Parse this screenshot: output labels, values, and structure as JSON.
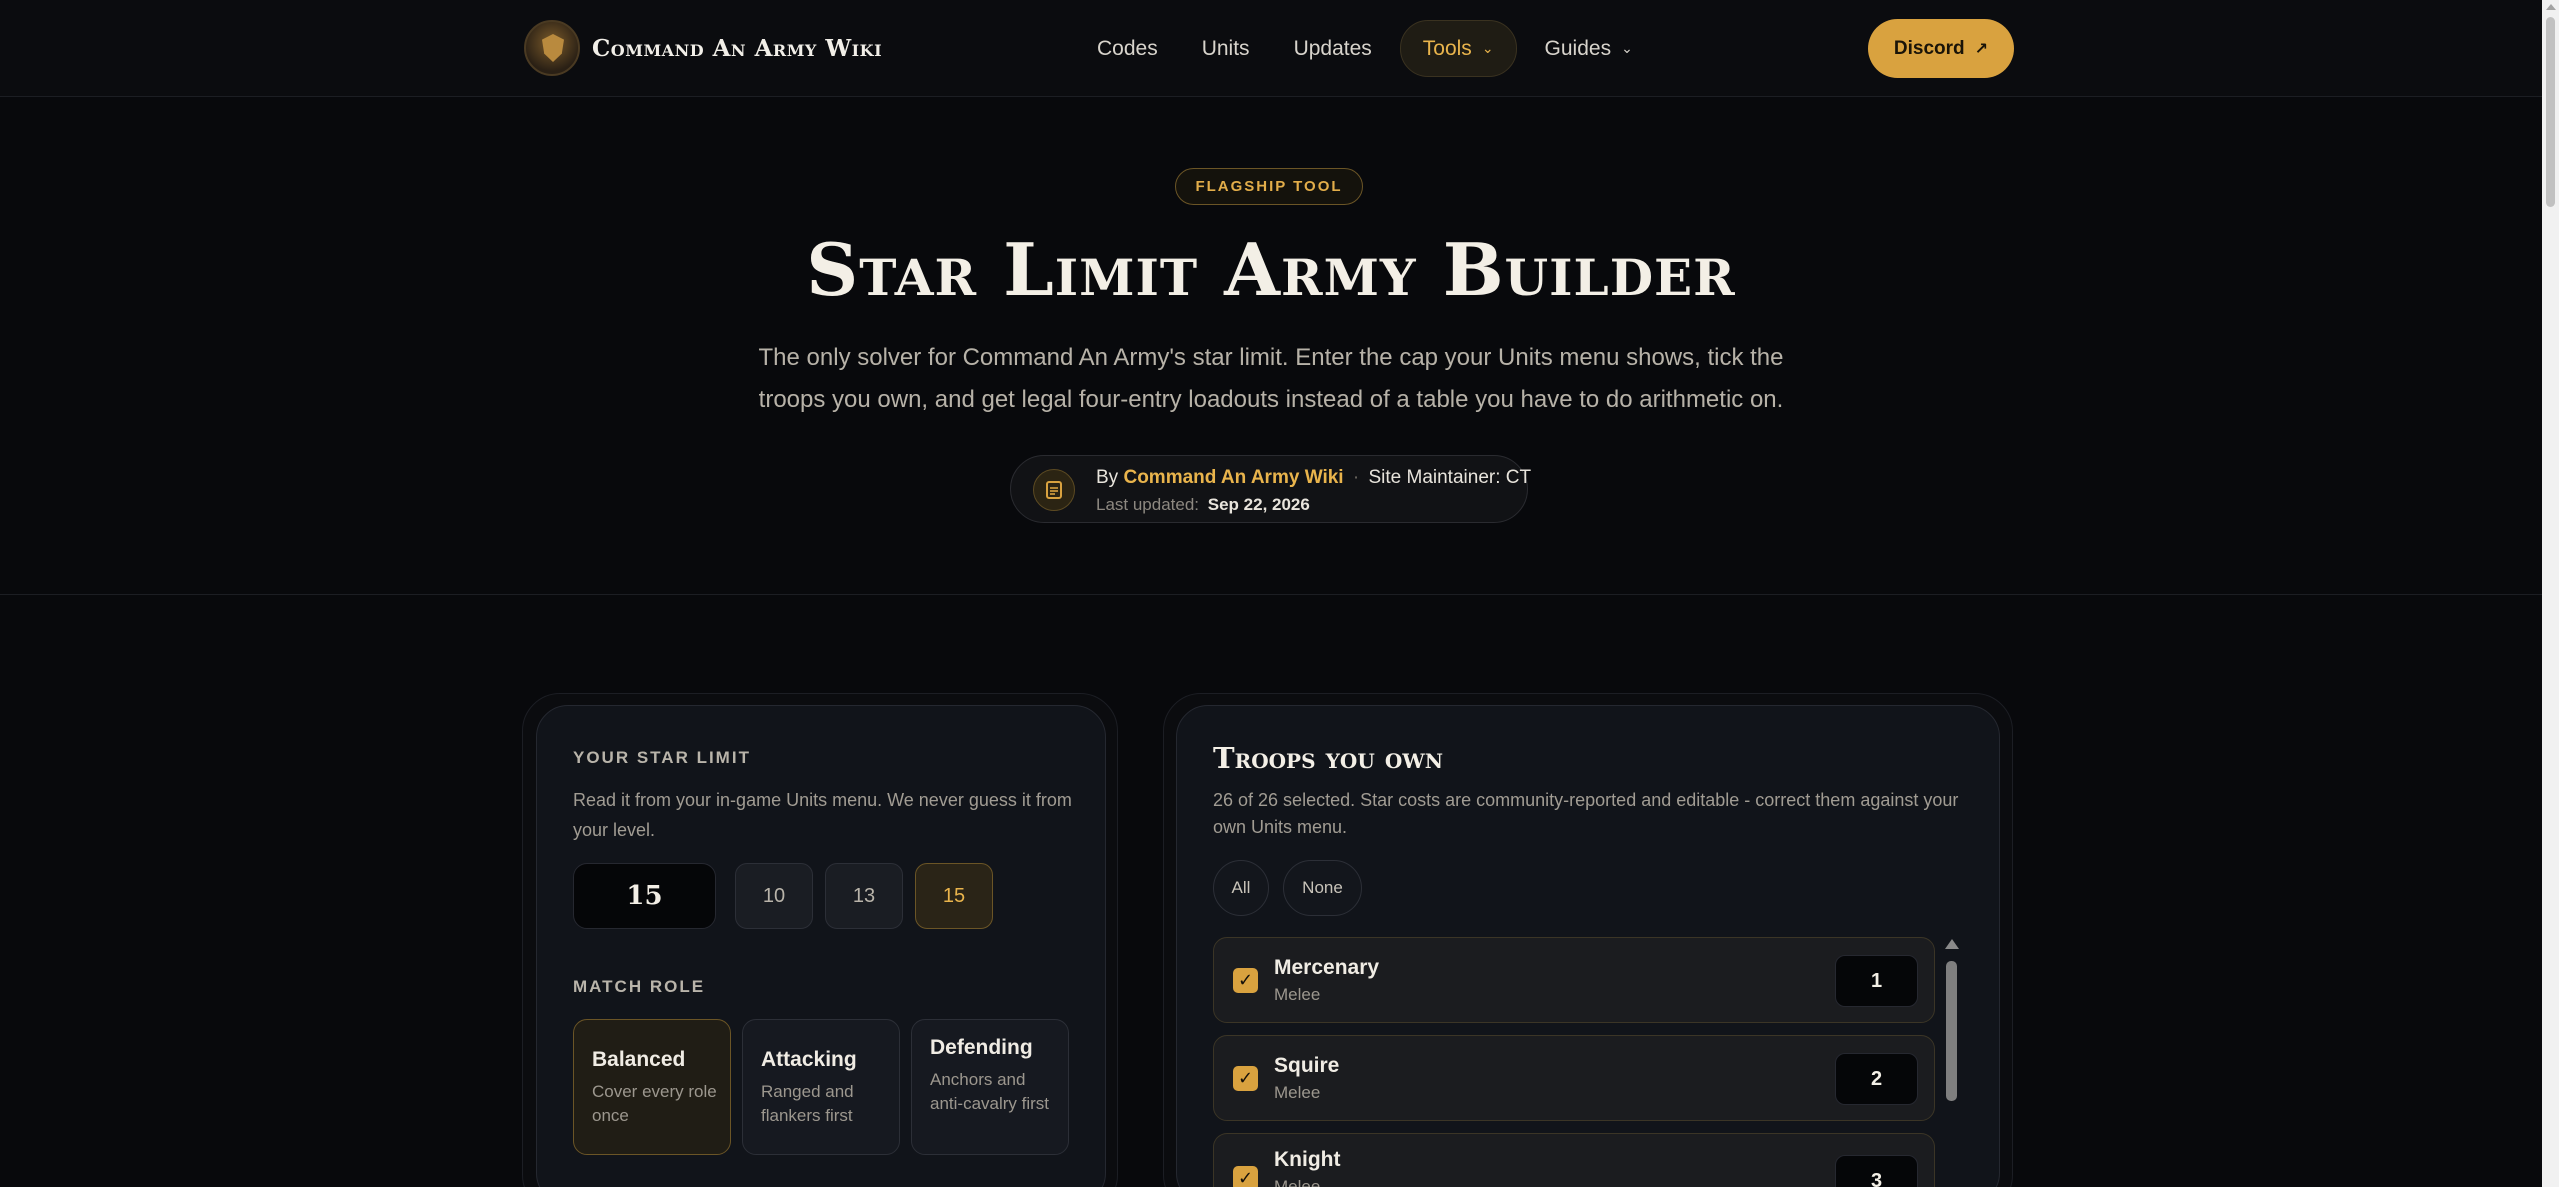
{
  "nav": {
    "brand": "Command An Army Wiki",
    "links": [
      "Codes",
      "Units",
      "Updates",
      "Tools",
      "Guides"
    ],
    "chevron": "⌄",
    "discord_label": "Discord",
    "discord_arrow": "↗",
    "accent_color": "#d9a23f"
  },
  "hero": {
    "badge": "FLAGSHIP TOOL",
    "title": "Star Limit Army Builder",
    "description": "The only solver for Command An Army's star limit. Enter the cap your Units menu shows, tick the troops you own, and get legal four-entry loadouts instead of a table you have to do arithmetic on.",
    "byline": {
      "by": "By",
      "author": "Command An Army Wiki",
      "sep": "·",
      "maintainer": "Site Maintainer: CT",
      "updated_label": "Last updated:",
      "updated_date": "Sep 22, 2026"
    }
  },
  "star_limit": {
    "label": "YOUR STAR LIMIT",
    "description": "Read it from your in-game Units menu. We never guess it from your level.",
    "value": "15",
    "presets": [
      "10",
      "13",
      "15"
    ],
    "active_preset": "15"
  },
  "match_role": {
    "label": "MATCH ROLE",
    "roles": [
      {
        "title": "Balanced",
        "desc": "Cover every role once"
      },
      {
        "title": "Attacking",
        "desc": "Ranged and flankers first"
      },
      {
        "title": "Defending",
        "desc": "Anchors and anti-cavalry first"
      }
    ],
    "active": "Balanced"
  },
  "troops": {
    "title": "Troops you own",
    "description": "26 of 26 selected. Star costs are community-reported and editable - correct them against your own Units menu.",
    "all_label": "All",
    "none_label": "None",
    "check_glyph": "✓",
    "items": [
      {
        "name": "Mercenary",
        "type": "Melee",
        "cost": "1"
      },
      {
        "name": "Squire",
        "type": "Melee",
        "cost": "2"
      },
      {
        "name": "Knight",
        "type": "Melee",
        "cost": "3"
      }
    ]
  }
}
